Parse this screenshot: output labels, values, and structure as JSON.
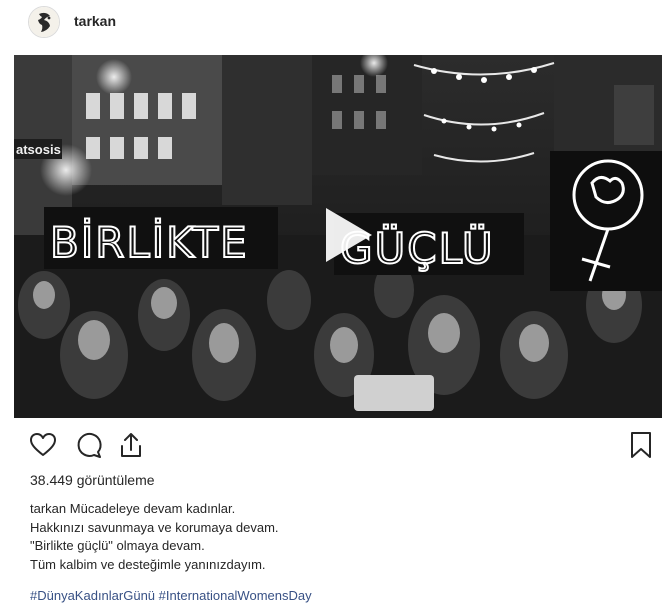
{
  "post": {
    "username": "tarkan",
    "media": {
      "type": "video",
      "sign_left": "BİRLİKTE",
      "sign_right": "GÜÇLÜ",
      "shop_sign": "atsosis"
    },
    "views_text": "38.449 görüntüleme",
    "caption": {
      "username": "tarkan",
      "lines": [
        "Mücadeleye devam kadınlar.",
        "Hakkınızı savunmaya ve korumaya devam.",
        "\"Birlikte güçlü\" olmaya devam.",
        "Tüm kalbim ve desteğimle yanınızdayım."
      ]
    },
    "hashtags": [
      "#DünyaKadınlarGünü",
      "#InternationalWomensDay"
    ],
    "icons": {
      "like": "heart-icon",
      "comment": "comment-icon",
      "share": "share-icon",
      "save": "bookmark-icon",
      "play": "play-icon"
    },
    "colors": {
      "text": "#262626",
      "link": "#385185",
      "icon": "#262626"
    }
  }
}
